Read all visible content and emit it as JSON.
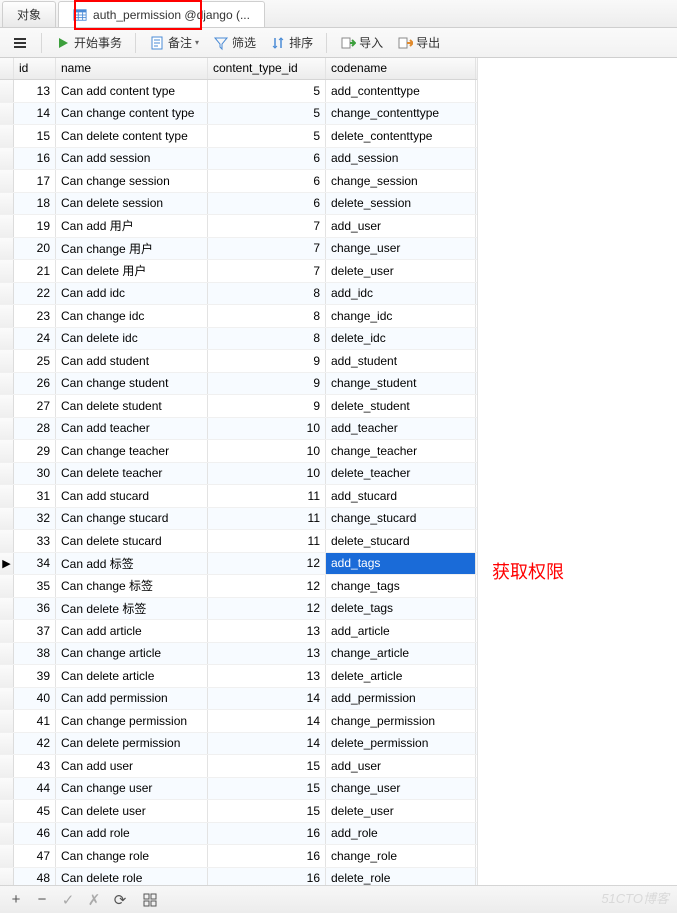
{
  "tabs": [
    {
      "label": "对象",
      "active": false
    },
    {
      "label": "auth_permission @django (...",
      "active": true
    }
  ],
  "toolbar": {
    "menu_icon": "menu-icon",
    "start_transaction": "开始事务",
    "note": "备注",
    "filter": "筛选",
    "sort": "排序",
    "import": "导入",
    "export": "导出"
  },
  "columns": {
    "id": "id",
    "name": "name",
    "content_type_id": "content_type_id",
    "codename": "codename"
  },
  "selected_row_index": 21,
  "rows": [
    {
      "id": 13,
      "name": "Can add content type",
      "ctid": 5,
      "code": "add_contenttype"
    },
    {
      "id": 14,
      "name": "Can change content type",
      "ctid": 5,
      "code": "change_contenttype"
    },
    {
      "id": 15,
      "name": "Can delete content type",
      "ctid": 5,
      "code": "delete_contenttype"
    },
    {
      "id": 16,
      "name": "Can add session",
      "ctid": 6,
      "code": "add_session"
    },
    {
      "id": 17,
      "name": "Can change session",
      "ctid": 6,
      "code": "change_session"
    },
    {
      "id": 18,
      "name": "Can delete session",
      "ctid": 6,
      "code": "delete_session"
    },
    {
      "id": 19,
      "name": "Can add 用户",
      "ctid": 7,
      "code": "add_user"
    },
    {
      "id": 20,
      "name": "Can change 用户",
      "ctid": 7,
      "code": "change_user"
    },
    {
      "id": 21,
      "name": "Can delete 用户",
      "ctid": 7,
      "code": "delete_user"
    },
    {
      "id": 22,
      "name": "Can add idc",
      "ctid": 8,
      "code": "add_idc"
    },
    {
      "id": 23,
      "name": "Can change idc",
      "ctid": 8,
      "code": "change_idc"
    },
    {
      "id": 24,
      "name": "Can delete idc",
      "ctid": 8,
      "code": "delete_idc"
    },
    {
      "id": 25,
      "name": "Can add student",
      "ctid": 9,
      "code": "add_student"
    },
    {
      "id": 26,
      "name": "Can change student",
      "ctid": 9,
      "code": "change_student"
    },
    {
      "id": 27,
      "name": "Can delete student",
      "ctid": 9,
      "code": "delete_student"
    },
    {
      "id": 28,
      "name": "Can add teacher",
      "ctid": 10,
      "code": "add_teacher"
    },
    {
      "id": 29,
      "name": "Can change teacher",
      "ctid": 10,
      "code": "change_teacher"
    },
    {
      "id": 30,
      "name": "Can delete teacher",
      "ctid": 10,
      "code": "delete_teacher"
    },
    {
      "id": 31,
      "name": "Can add stucard",
      "ctid": 11,
      "code": "add_stucard"
    },
    {
      "id": 32,
      "name": "Can change stucard",
      "ctid": 11,
      "code": "change_stucard"
    },
    {
      "id": 33,
      "name": "Can delete stucard",
      "ctid": 11,
      "code": "delete_stucard"
    },
    {
      "id": 34,
      "name": "Can add 标签",
      "ctid": 12,
      "code": "add_tags"
    },
    {
      "id": 35,
      "name": "Can change 标签",
      "ctid": 12,
      "code": "change_tags"
    },
    {
      "id": 36,
      "name": "Can delete 标签",
      "ctid": 12,
      "code": "delete_tags"
    },
    {
      "id": 37,
      "name": "Can add article",
      "ctid": 13,
      "code": "add_article"
    },
    {
      "id": 38,
      "name": "Can change article",
      "ctid": 13,
      "code": "change_article"
    },
    {
      "id": 39,
      "name": "Can delete article",
      "ctid": 13,
      "code": "delete_article"
    },
    {
      "id": 40,
      "name": "Can add permission",
      "ctid": 14,
      "code": "add_permission"
    },
    {
      "id": 41,
      "name": "Can change permission",
      "ctid": 14,
      "code": "change_permission"
    },
    {
      "id": 42,
      "name": "Can delete permission",
      "ctid": 14,
      "code": "delete_permission"
    },
    {
      "id": 43,
      "name": "Can add user",
      "ctid": 15,
      "code": "add_user"
    },
    {
      "id": 44,
      "name": "Can change user",
      "ctid": 15,
      "code": "change_user"
    },
    {
      "id": 45,
      "name": "Can delete user",
      "ctid": 15,
      "code": "delete_user"
    },
    {
      "id": 46,
      "name": "Can add role",
      "ctid": 16,
      "code": "add_role"
    },
    {
      "id": 47,
      "name": "Can change role",
      "ctid": 16,
      "code": "change_role"
    },
    {
      "id": 48,
      "name": "Can delete role",
      "ctid": 16,
      "code": "delete_role"
    }
  ],
  "annotation": "获取权限",
  "watermark": "51CTO博客",
  "footer_icons": {
    "plus": "+",
    "minus": "−",
    "check": "✓",
    "cancel": "✗",
    "refresh": "⟳"
  }
}
